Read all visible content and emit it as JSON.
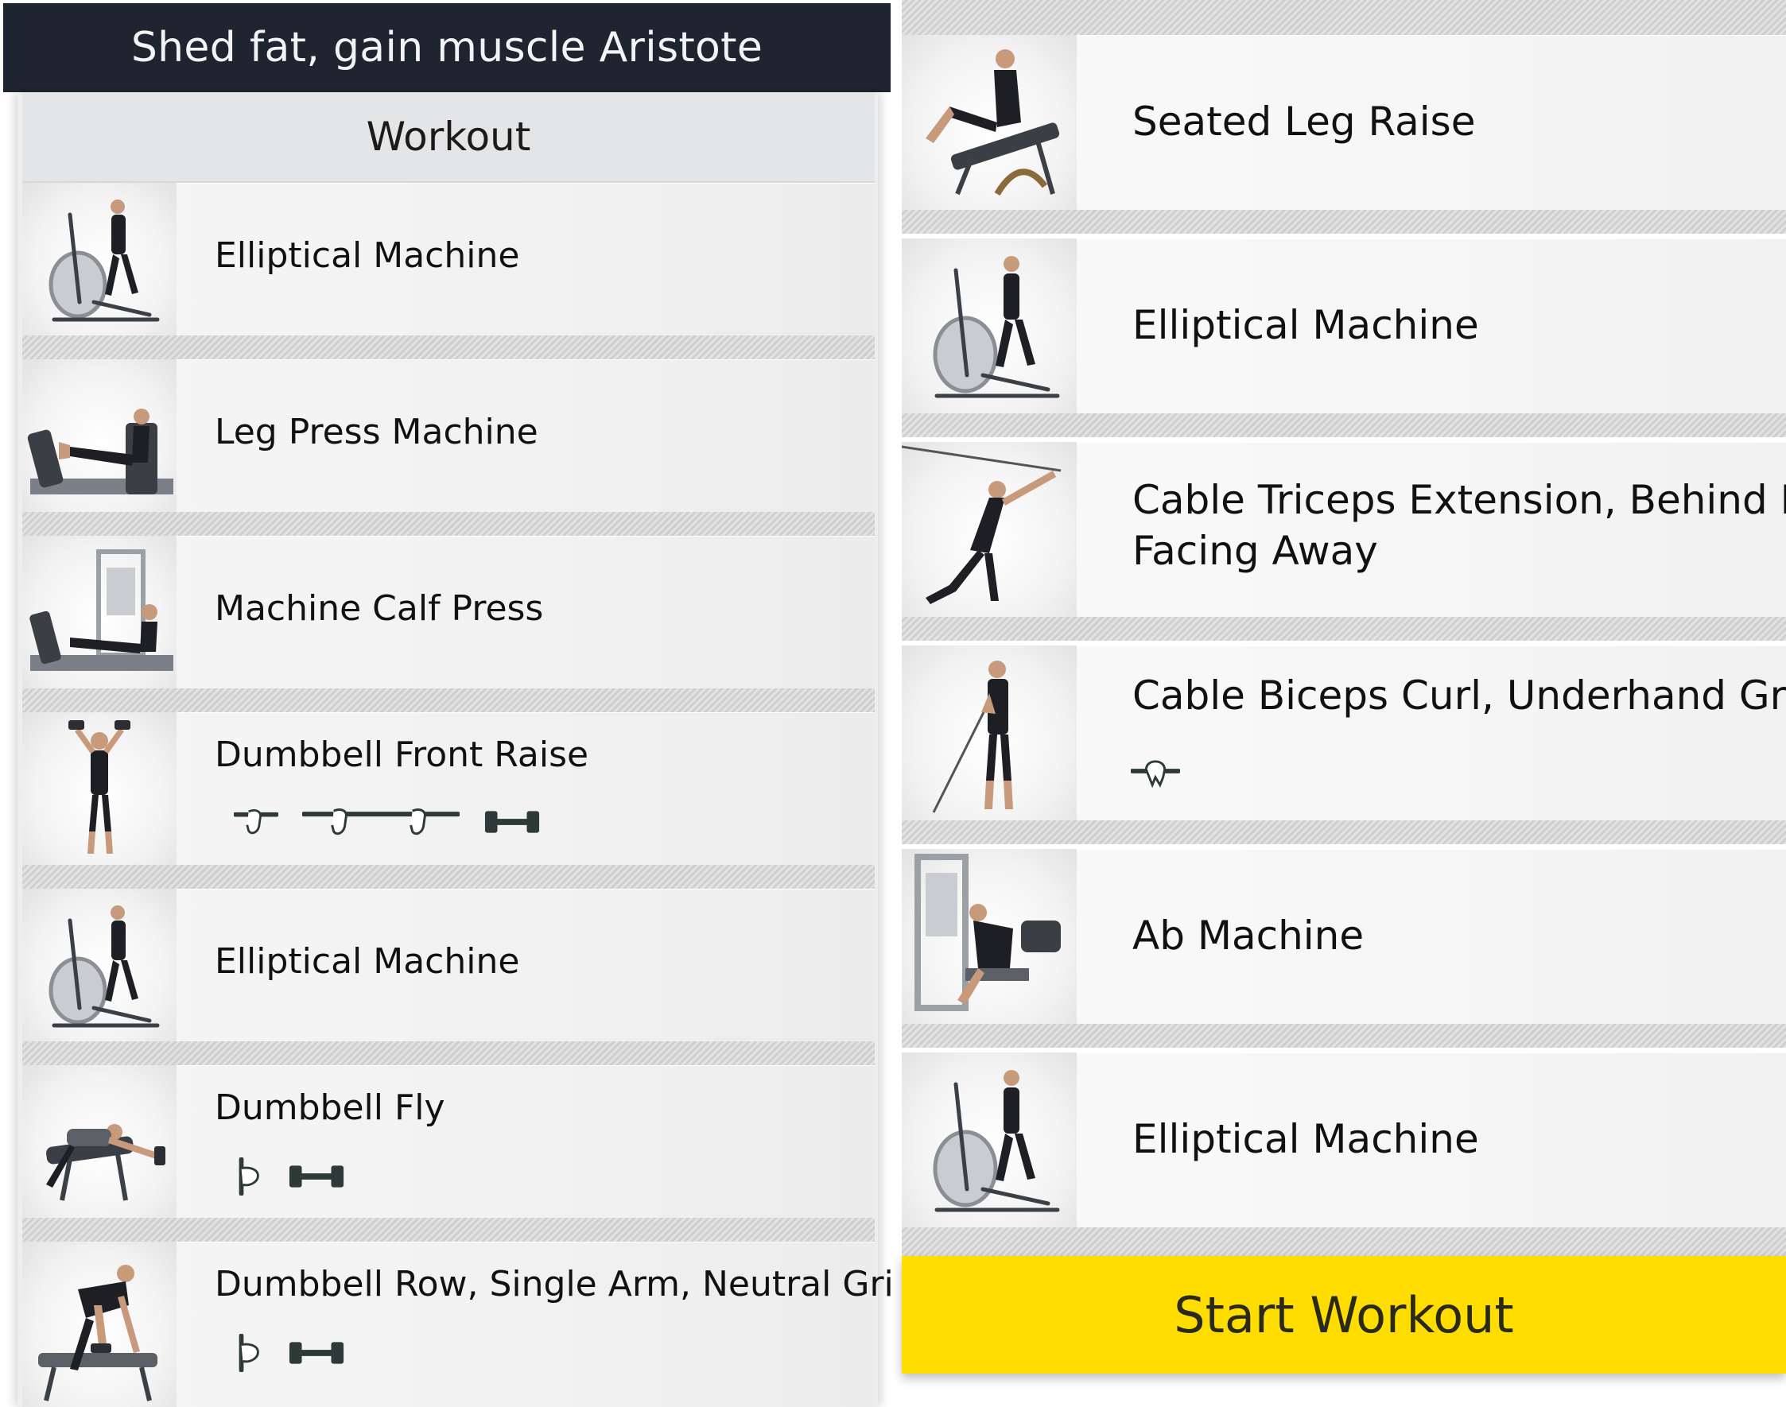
{
  "header": {
    "title": "Shed fat, gain muscle Aristote"
  },
  "section": {
    "title": "Workout"
  },
  "left_exercises": [
    {
      "name": "Elliptical Machine",
      "image": "elliptical-machine-thumbnail"
    },
    {
      "name": "Leg Press Machine",
      "image": "leg-press-thumbnail"
    },
    {
      "name": "Machine Calf Press",
      "image": "calf-press-thumbnail"
    },
    {
      "name": "Dumbbell Front Raise",
      "image": "front-raise-thumbnail",
      "equipment": [
        "single-hand-grip-icon",
        "barbell-grip-icon",
        "dumbbell-icon"
      ]
    },
    {
      "name": "Elliptical Machine",
      "image": "elliptical-machine-thumbnail"
    },
    {
      "name": "Dumbbell Fly",
      "image": "dumbbell-fly-thumbnail",
      "equipment": [
        "neutral-grip-icon",
        "dumbbell-icon"
      ]
    },
    {
      "name": "Dumbbell Row, Single Arm, Neutral Grip",
      "image": "dumbbell-row-thumbnail",
      "equipment": [
        "neutral-grip-icon",
        "dumbbell-icon"
      ]
    }
  ],
  "right_exercises": [
    {
      "name": "Seated Leg Raise",
      "image": "seated-leg-raise-thumbnail"
    },
    {
      "name": "Elliptical Machine",
      "image": "elliptical-machine-thumbnail"
    },
    {
      "name_line1": "Cable Triceps Extension, Behind Neck,",
      "name_line2": "Facing Away",
      "image": "cable-triceps-thumbnail"
    },
    {
      "name": "Cable Biceps Curl, Underhand Grip",
      "image": "cable-biceps-thumbnail",
      "equipment": [
        "underhand-grip-icon"
      ]
    },
    {
      "name": "Ab Machine",
      "image": "ab-machine-thumbnail"
    },
    {
      "name": "Elliptical Machine",
      "image": "elliptical-machine-thumbnail"
    }
  ],
  "actions": {
    "start_workout": "Start Workout"
  },
  "colors": {
    "appbar": "#1e2530",
    "accent": "#ffdd00",
    "row": "#f4f4f4",
    "separator": "#d4d4d4"
  }
}
